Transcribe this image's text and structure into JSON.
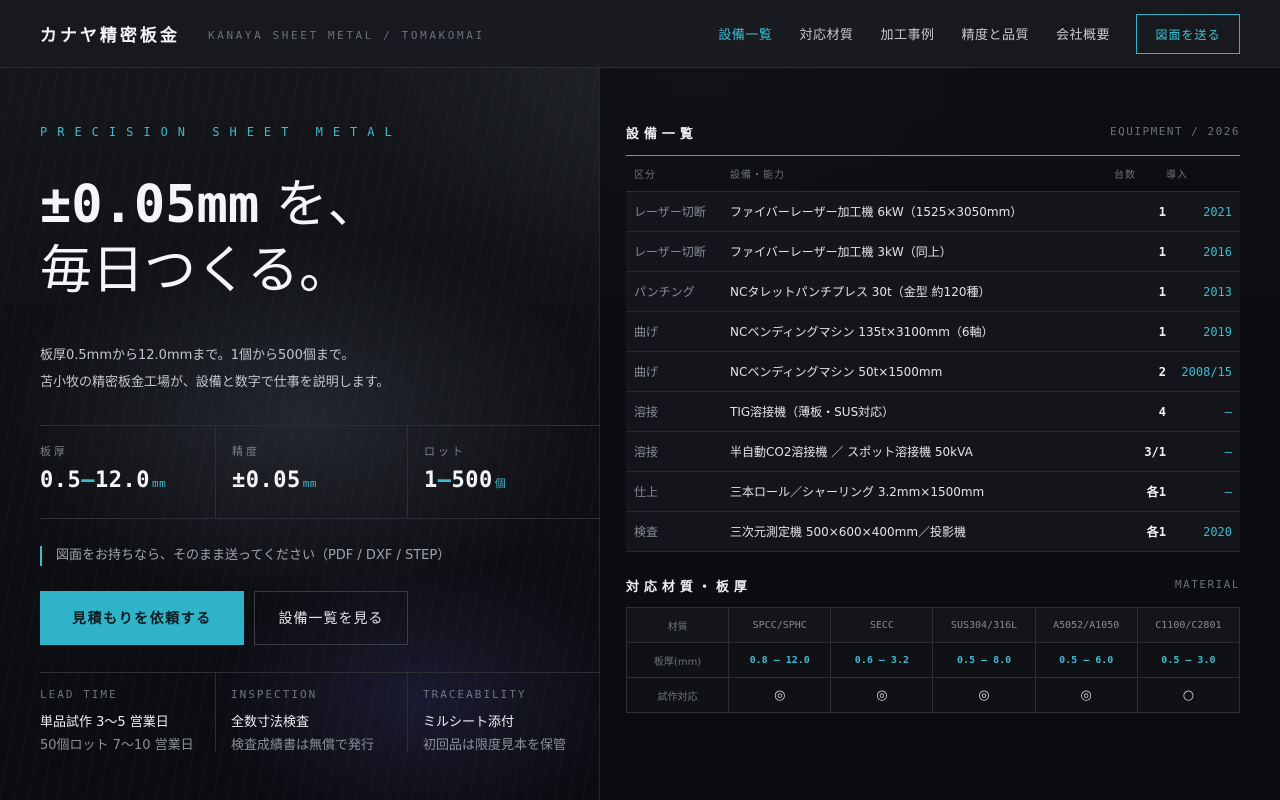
{
  "header": {
    "logo": "カナヤ精密板金",
    "logo_sub": "KANAYA SHEET METAL / TOMAKOMAI",
    "nav": [
      "設備一覧",
      "対応材質",
      "加工事例",
      "精度と品質",
      "会社概要"
    ],
    "cta": "図面を送る",
    "colors": {
      "accent": "#3fb9cf"
    }
  },
  "hero": {
    "eyebrow": "PRECISION SHEET METAL",
    "headline_mono": "±0.05mm",
    "headline_1": " を、",
    "headline_2": "毎日つくる。",
    "lead_1": "板厚0.5mmから12.0mmまで。1個から500個まで。",
    "lead_2": "苫小牧の精密板金工場が、設備と数字で仕事を説明します。",
    "stats": [
      {
        "label": "板厚",
        "value_a": "0.5",
        "dash": "—",
        "value_b": "12.0",
        "unit": "mm"
      },
      {
        "label": "精度",
        "value": "±0.05",
        "unit": "mm"
      },
      {
        "label": "ロット",
        "value_a": "1",
        "dash": "—",
        "value_b": "500",
        "unit": "個"
      }
    ],
    "note": "図面をお持ちなら、そのまま送ってください（PDF / DXF / STEP）",
    "btn_primary": "見積もりを依頼する",
    "btn_secondary": "設備一覧を見る",
    "features": [
      {
        "label": "LEAD TIME",
        "main": "単品試作 3〜5 営業日",
        "sub": "50個ロット 7〜10 営業日"
      },
      {
        "label": "INSPECTION",
        "main": "全数寸法検査",
        "sub": "検査成績書は無償で発行"
      },
      {
        "label": "TRACEABILITY",
        "main": "ミルシート添付",
        "sub": "初回品は限度見本を保管"
      }
    ]
  },
  "equipment": {
    "title": "設備一覧",
    "tag": "EQUIPMENT / 2026",
    "headers": {
      "category": "区分",
      "spec": "設備・能力",
      "count": "台数",
      "year": "導入"
    },
    "rows": [
      {
        "category": "レーザー切断",
        "spec": "ファイバーレーザー加工機 6kW（1525×3050mm）",
        "count": "1",
        "year": "2021"
      },
      {
        "category": "レーザー切断",
        "spec": "ファイバーレーザー加工機 3kW（同上）",
        "count": "1",
        "year": "2016"
      },
      {
        "category": "パンチング",
        "spec": "NCタレットパンチプレス 30t（金型 約120種）",
        "count": "1",
        "year": "2013"
      },
      {
        "category": "曲げ",
        "spec": "NCベンディングマシン 135t×3100mm（6軸）",
        "count": "1",
        "year": "2019"
      },
      {
        "category": "曲げ",
        "spec": "NCベンディングマシン 50t×1500mm",
        "count": "2",
        "year": "2008/15"
      },
      {
        "category": "溶接",
        "spec": "TIG溶接機（薄板・SUS対応）",
        "count": "4",
        "year": "—"
      },
      {
        "category": "溶接",
        "spec": "半自動CO2溶接機 ／ スポット溶接機 50kVA",
        "count": "3/1",
        "year": "—"
      },
      {
        "category": "仕上",
        "spec": "三本ロール／シャーリング 3.2mm×1500mm",
        "count": "各1",
        "year": "—"
      },
      {
        "category": "検査",
        "spec": "三次元測定機 500×600×400mm／投影機",
        "count": "各1",
        "year": "2020"
      }
    ]
  },
  "materials": {
    "title": "対応材質・板厚",
    "tag": "MATERIAL",
    "header_label": "材質",
    "columns": [
      "SPCC/SPHC",
      "SECC",
      "SUS304/316L",
      "A5052/A1050",
      "C1100/C2801"
    ],
    "thickness_label": "板厚(mm)",
    "thickness": [
      "0.8 — 12.0",
      "0.6 — 3.2",
      "0.5 — 8.0",
      "0.5 — 6.0",
      "0.5 — 3.0"
    ],
    "prototype_label": "試作対応",
    "prototype": [
      "◎",
      "◎",
      "◎",
      "◎",
      "○"
    ]
  }
}
